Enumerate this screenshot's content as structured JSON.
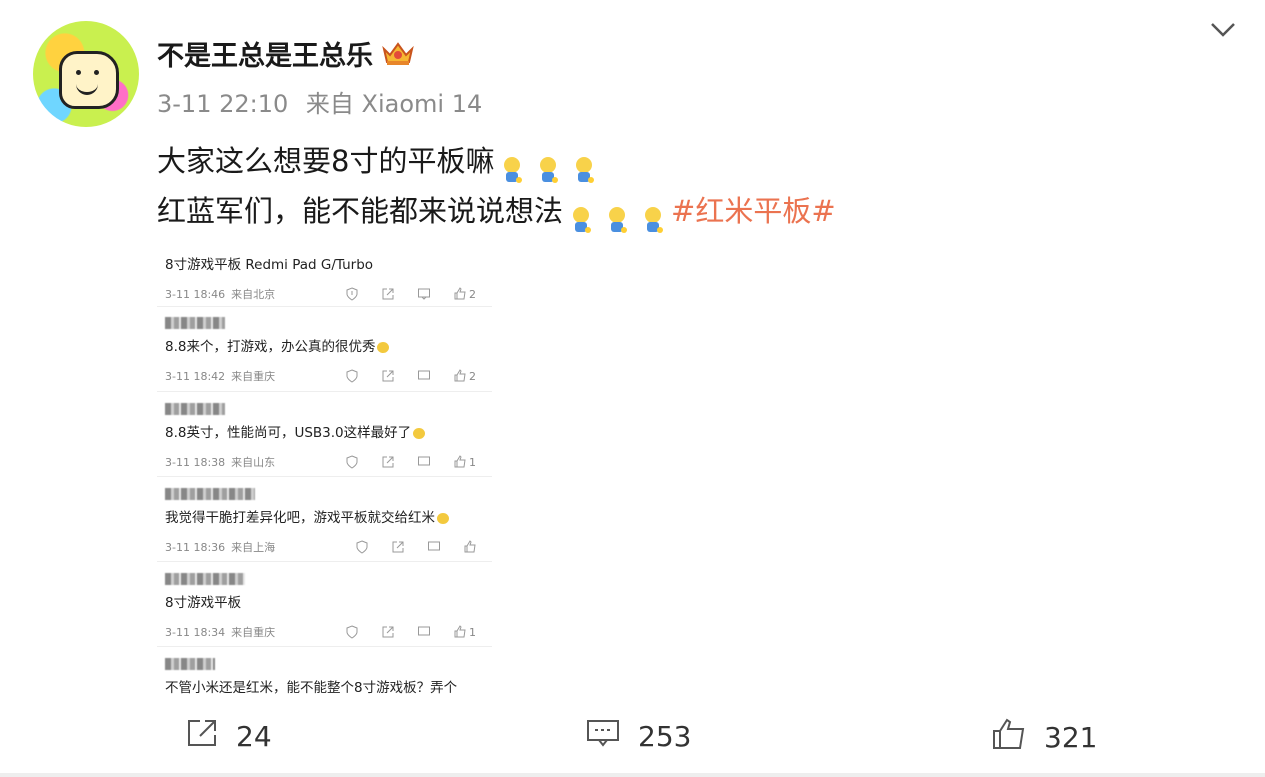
{
  "post": {
    "username": "不是王总是王总乐",
    "time": "3-11 22:10",
    "source": "来自 Xiaomi 14",
    "line1": "大家这么想要8寸的平板嘛",
    "line2": "红蓝军们，能不能都来说说想法",
    "hashtag": "#红米平板#"
  },
  "screenshot": {
    "title": "8寸游戏平板 Redmi Pad G/Turbo",
    "title_meta": {
      "time": "3-11 18:46",
      "loc": "来自北京",
      "likes": "2"
    },
    "comments": [
      {
        "text": "8.8来个，打游戏，办公真的很优秀",
        "time": "3-11 18:42",
        "loc": "来自重庆",
        "likes": "2"
      },
      {
        "text": "8.8英寸，性能尚可，USB3.0这样最好了",
        "time": "3-11 18:38",
        "loc": "来自山东",
        "likes": "1"
      },
      {
        "text": "我觉得干脆打差异化吧，游戏平板就交给红米",
        "time": "3-11 18:36",
        "loc": "来自上海",
        "likes": ""
      },
      {
        "text": "8寸游戏平板",
        "time": "3-11 18:34",
        "loc": "来自重庆",
        "likes": "1"
      },
      {
        "text": "不管小米还是红米，能不能整个8寸游戏板？弄个",
        "time": "",
        "loc": "",
        "likes": ""
      }
    ]
  },
  "actions": {
    "repost": "24",
    "comment": "253",
    "like": "321"
  },
  "colors": {
    "hashtag": "#eb7350",
    "meta": "#8a8a8a"
  }
}
